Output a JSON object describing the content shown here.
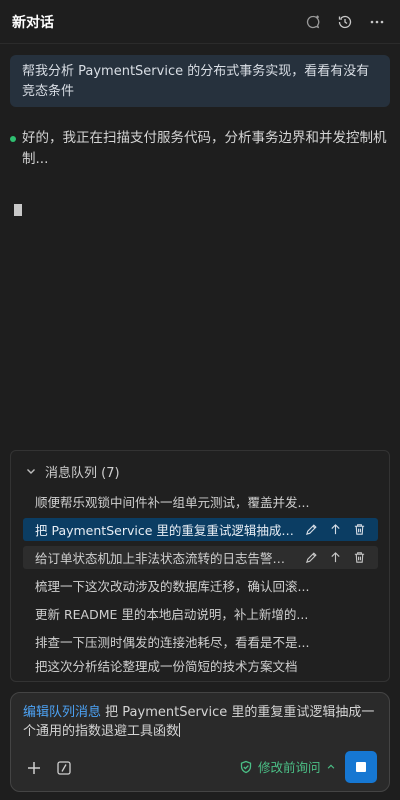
{
  "header": {
    "title": "新对话"
  },
  "user_message": "帮我分析 PaymentService 的分布式事务实现，看看有没有竞态条件",
  "assistant_status": "好的，我正在扫描支付服务代码，分析事务边界和并发控制机制...",
  "queue": {
    "title": "消息队列 (7)",
    "items": [
      {
        "text": "顺便帮乐观锁中间件补一组单元测试，覆盖并发..."
      },
      {
        "text": "把 PaymentService 里的重复重试逻辑抽成一个..."
      },
      {
        "text": "给订单状态机加上非法状态流转的日志告警，方..."
      },
      {
        "text": "梳理一下这次改动涉及的数据库迁移，确认回滚..."
      },
      {
        "text": "更新 README 里的本地启动说明，补上新增的..."
      },
      {
        "text": "排查一下压测时偶发的连接池耗尽，看看是不是..."
      },
      {
        "text": "把这次分析结论整理成一份简短的技术方案文档"
      }
    ]
  },
  "composer": {
    "edit_label": "编辑队列消息",
    "text": "把 PaymentService 里的重复重试逻辑抽成一个通用的指数退避工具函数",
    "mode_label": "修改前询问"
  },
  "colors": {
    "accent": "#1677d2",
    "active_row": "#0b3d63",
    "status_green": "#2fbf71",
    "link_blue": "#4da3f5"
  }
}
